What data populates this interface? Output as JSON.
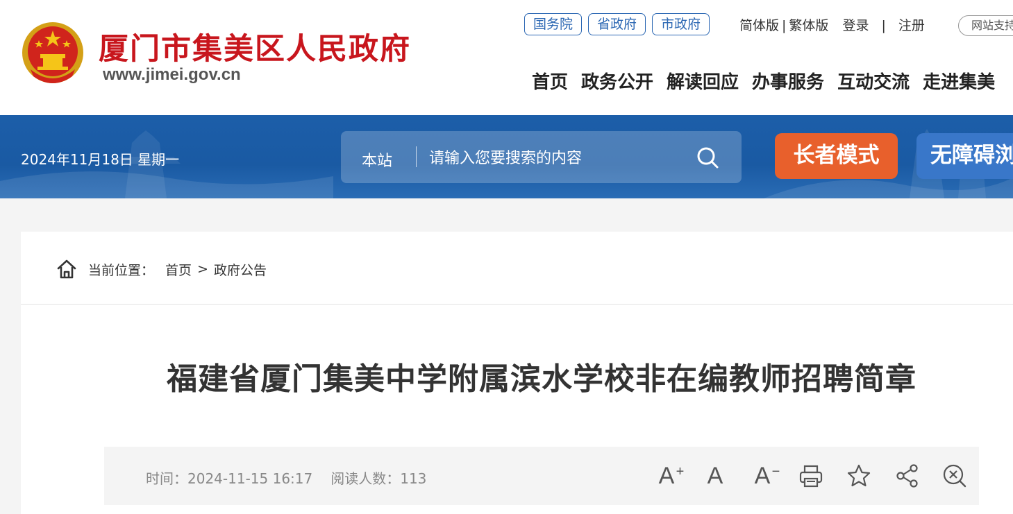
{
  "header": {
    "site_title": "厦门市集美区人民政府",
    "site_url": "www.jimei.gov.cn",
    "gov_links": [
      "国务院",
      "省政府",
      "市政府"
    ],
    "simplified": "简体版",
    "traditional": "繁体版",
    "login": "登录",
    "register": "注册",
    "site_search": "网站支持"
  },
  "nav": {
    "items": [
      "首页",
      "政务公开",
      "解读回应",
      "办事服务",
      "互动交流",
      "走进集美"
    ]
  },
  "banner": {
    "date": "2024年11月18日 星期一",
    "search_scope": "本站",
    "search_placeholder": "请输入您要搜索的内容",
    "elder_mode": "长者模式",
    "accessibility": "无障碍浏览"
  },
  "breadcrumb": {
    "label": "当前位置：",
    "home": "首页",
    "separator": ">",
    "current": "政府公告"
  },
  "article": {
    "title": "福建省厦门集美中学附属滨水学校非在编教师招聘简章",
    "time_label": "时间：",
    "time": "2024-11-15 16:17",
    "reads_label": "阅读人数：",
    "reads": "113"
  },
  "tools": {
    "increase_font": "A",
    "normal_font": "A",
    "decrease_font": "A",
    "plus": "+",
    "minus": "−"
  },
  "colors": {
    "brand_red": "#c8161d",
    "banner_blue": "#1c5ea9",
    "link_blue": "#2b67b3",
    "elder_orange": "#e8602c",
    "access_blue": "#3977c9"
  }
}
